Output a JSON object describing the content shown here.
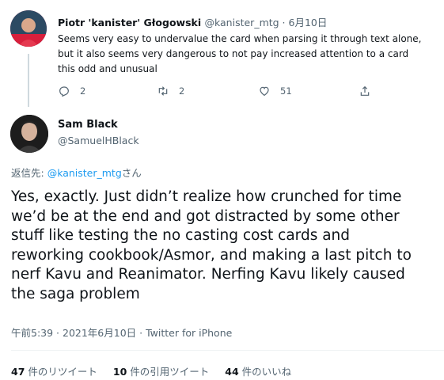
{
  "prev_tweet": {
    "name": "Piotr 'kanister' Głogowski",
    "handle_date": "@kanister_mtg · 6月10日",
    "lines": [
      "Seems very easy to undervalue the card when parsing it through text alone,",
      "but it also seems very dangerous to not pay increased attention to a card",
      "this odd and unusual"
    ],
    "replies": "2",
    "retweets": "2",
    "likes": "51"
  },
  "main_tweet": {
    "name": "Sam Black",
    "handle": "@SamuelHBlack",
    "reply_prefix": "返信先: ",
    "reply_to": "@kanister_mtg",
    "reply_suffix": "さん",
    "lines": [
      "Yes, exactly. Just didn’t realize how crunched for time",
      "we’d be at the end and got distracted by some other",
      "stuff like testing the no casting cost cards and",
      "reworking cookbook/Asmor, and making a last pitch to",
      "nerf Kavu and Reanimator. Nerfing Kavu likely caused",
      "the saga problem"
    ],
    "meta": "午前5:39 · 2021年6月10日 · Twitter for iPhone",
    "retweets_count": "47",
    "retweets_label": " 件のリツイート",
    "quotes_count": "10",
    "quotes_label": " 件の引用ツイート",
    "likes_count": "44",
    "likes_label": " 件のいいね"
  },
  "colors": {
    "link": "#1d9bf0",
    "muted": "#536471",
    "text": "#0f1419"
  }
}
